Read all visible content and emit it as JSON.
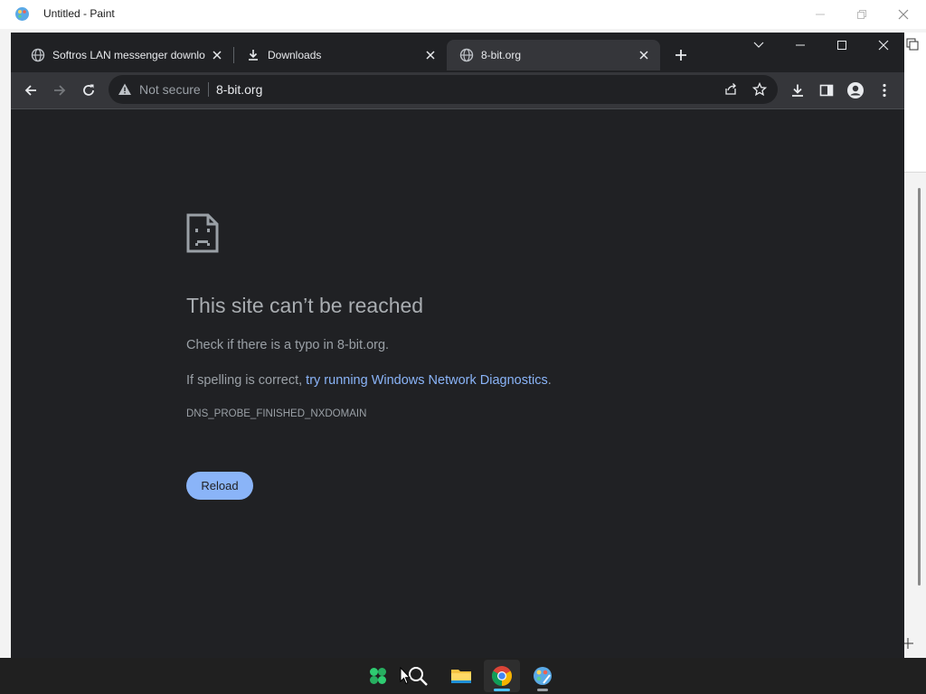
{
  "paint": {
    "window_title": "Untitled - Paint",
    "icon": "paint-palette-icon"
  },
  "chrome": {
    "tabs": [
      {
        "title": "Softros LAN messenger downlo",
        "icon": "globe-icon",
        "active": false
      },
      {
        "title": "Downloads",
        "icon": "download-icon",
        "active": false
      },
      {
        "title": "8-bit.org",
        "icon": "globe-icon",
        "active": true
      }
    ],
    "toolbar": {
      "security_label": "Not secure",
      "url": "8-bit.org"
    },
    "error_page": {
      "title": "This site can’t be reached",
      "line1": "Check if there is a typo in 8-bit.org.",
      "line2_prefix": "If spelling is correct, ",
      "line2_link": "try running Windows Network Diagnostics",
      "line2_suffix": ".",
      "error_code": "DNS_PROBE_FINISHED_NXDOMAIN",
      "reload_label": "Reload"
    }
  },
  "taskbar": {
    "apps": [
      "start-icon",
      "search-icon",
      "file-explorer-icon",
      "chrome-icon",
      "paint-icon"
    ]
  },
  "colors": {
    "chrome_frame": "#202124",
    "chrome_toolbar": "#35363a",
    "link_blue": "#8ab4f8",
    "taskbar": "#202020"
  }
}
